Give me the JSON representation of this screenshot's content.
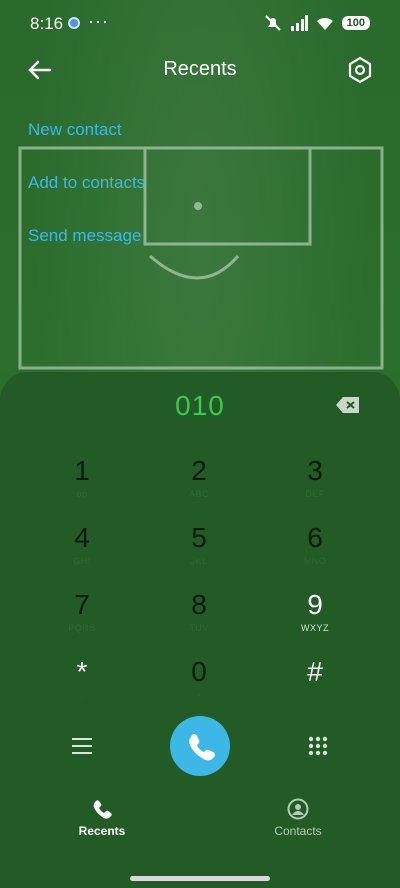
{
  "status_bar": {
    "time": "8:16",
    "more": "···",
    "battery": "100"
  },
  "header": {
    "title": "Recents"
  },
  "actions": [
    {
      "label": "New contact"
    },
    {
      "label": "Add to contacts"
    },
    {
      "label": "Send message"
    }
  ],
  "dialer": {
    "number": "010",
    "keys": [
      {
        "digit": "1",
        "letters": "oo"
      },
      {
        "digit": "2",
        "letters": "ABC"
      },
      {
        "digit": "3",
        "letters": "DEF"
      },
      {
        "digit": "4",
        "letters": "GHI"
      },
      {
        "digit": "5",
        "letters": "JKL"
      },
      {
        "digit": "6",
        "letters": "MNO"
      },
      {
        "digit": "7",
        "letters": "PQRS"
      },
      {
        "digit": "8",
        "letters": "TUV"
      },
      {
        "digit": "9",
        "letters": "WXYZ"
      },
      {
        "digit": "*",
        "letters": ","
      },
      {
        "digit": "0",
        "letters": "+"
      },
      {
        "digit": "#",
        "letters": ""
      }
    ]
  },
  "bottom_nav": {
    "recents": "Recents",
    "contacts": "Contacts"
  },
  "colors": {
    "accent": "#3db8e6",
    "number": "#3ec74f",
    "background": "#1f5a22"
  }
}
